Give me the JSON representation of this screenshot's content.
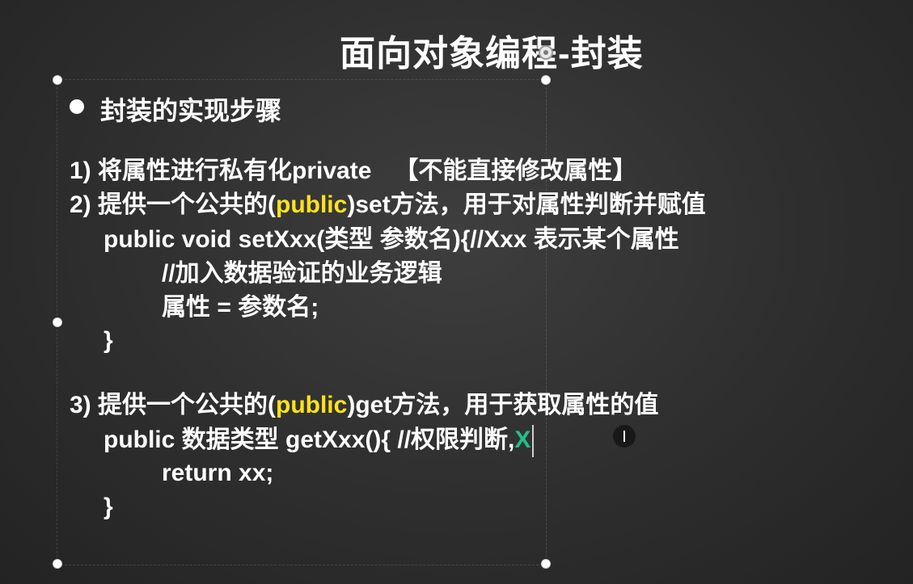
{
  "slide": {
    "title": "面向对象编程-封装",
    "bullet": "封装的实现步骤",
    "step1": {
      "text": "1) 将属性进行私有化private",
      "note": "【不能直接修改属性】"
    },
    "step2": {
      "prefix": "2) 提供一个公共的(",
      "keyword": "public",
      "suffix": ")set方法，用于对属性判断并赋值",
      "code": [
        "public void setXxx(类型 参数名){//Xxx 表示某个属性",
        "//加入数据验证的业务逻辑",
        "属性 = 参数名;",
        "}"
      ]
    },
    "step3": {
      "prefix": "3) 提供一个公共的(",
      "keyword": "public",
      "suffix": ")get方法，用于获取属性的值",
      "code_line1": "public 数据类型 getXxx(){ //权限判断,",
      "typed_char": "X",
      "code": [
        "return xx;",
        "}"
      ]
    }
  },
  "colors": {
    "background": "#2e2e2e",
    "text": "#ffffff",
    "keyword_highlight": "#ffe21a",
    "typed_char": "#1fc08a"
  },
  "icons": {
    "bullet": "bullet-dot-icon",
    "move_cursor": "move-cursor-icon",
    "text_cursor": "ibeam-cursor-icon"
  }
}
